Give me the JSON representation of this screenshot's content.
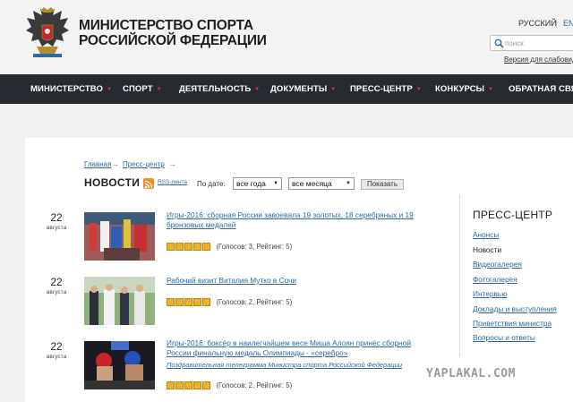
{
  "header": {
    "title_line1": "МИНИСТЕРСТВО СПОРТА",
    "title_line2": "РОССИЙСКОЙ ФЕДЕРАЦИИ",
    "lang_ru": "РУССКИЙ",
    "lang_sep": "|",
    "lang_en": "ENG",
    "search_placeholder": "поиск",
    "low_vision_link": "Версия для слабовидящих"
  },
  "nav": {
    "items": [
      {
        "label": "МИНИСТЕРСТВО"
      },
      {
        "label": "СПОРТ"
      },
      {
        "label": "ДЕЯТЕЛЬНОСТЬ"
      },
      {
        "label": "ДОКУМЕНТЫ"
      },
      {
        "label": "ПРЕСС-ЦЕНТР"
      },
      {
        "label": "КОНКУРСЫ"
      },
      {
        "label": "ОБРАТНАЯ СВЯЗЬ"
      }
    ],
    "caret": "▼"
  },
  "breadcrumb": {
    "home": "Главная",
    "section": "Пресс-центр",
    "arrow": "→"
  },
  "page": {
    "title": "НОВОСТИ",
    "rss_label": "RSS-лента",
    "filter_label": "По дате:",
    "year_select": "все года",
    "month_select": "все месяца",
    "show_button": "Показать",
    "select_arrow": "▼"
  },
  "news": [
    {
      "day": "22",
      "month": "августа",
      "title": "Игры-2016: сборная России завоевала 19 золотых, 18 серебряных и 19 бронзовых медалей",
      "subtitle": "",
      "rating_text": "(Голосов: 3, Рейтинг: 5)",
      "rating": 5
    },
    {
      "day": "22",
      "month": "августа",
      "title": "Рабочий визит Виталия Мутко в Сочи",
      "subtitle": "",
      "rating_text": "(Голосов: 2, Рейтинг: 5)",
      "rating": 5
    },
    {
      "day": "22",
      "month": "августа",
      "title": "Игры-2016: боксёр в наилегчайшем весе Миша Алоян принёс сборной России финальную медаль Олимпиады - «серебро»",
      "subtitle": "Поздравительная телеграмма Министра спорта Российской Федерации",
      "rating_text": "(Голосов: 2, Рейтинг: 5)",
      "rating": 5
    }
  ],
  "sidebar": {
    "title": "ПРЕСС-ЦЕНТР",
    "items": [
      {
        "label": "Анонсы",
        "current": false
      },
      {
        "label": "Новости",
        "current": true
      },
      {
        "label": "Видеогалерея",
        "current": false
      },
      {
        "label": "Фотогалерея",
        "current": false
      },
      {
        "label": "Интервью",
        "current": false
      },
      {
        "label": "Доклады и выступления",
        "current": false
      },
      {
        "label": "Приветствия министра",
        "current": false
      },
      {
        "label": "Вопросы и ответы",
        "current": false
      }
    ]
  },
  "watermark": "YAPLAKAL.COM",
  "colors": {
    "nav_bg": "#272a31",
    "nav_caret": "#e0342a",
    "link": "#2c6aa0",
    "star": "#e9b227",
    "rss": "#f0902d"
  },
  "icons": [
    "emblem-icon",
    "search-icon",
    "rss-icon",
    "star-icon"
  ]
}
